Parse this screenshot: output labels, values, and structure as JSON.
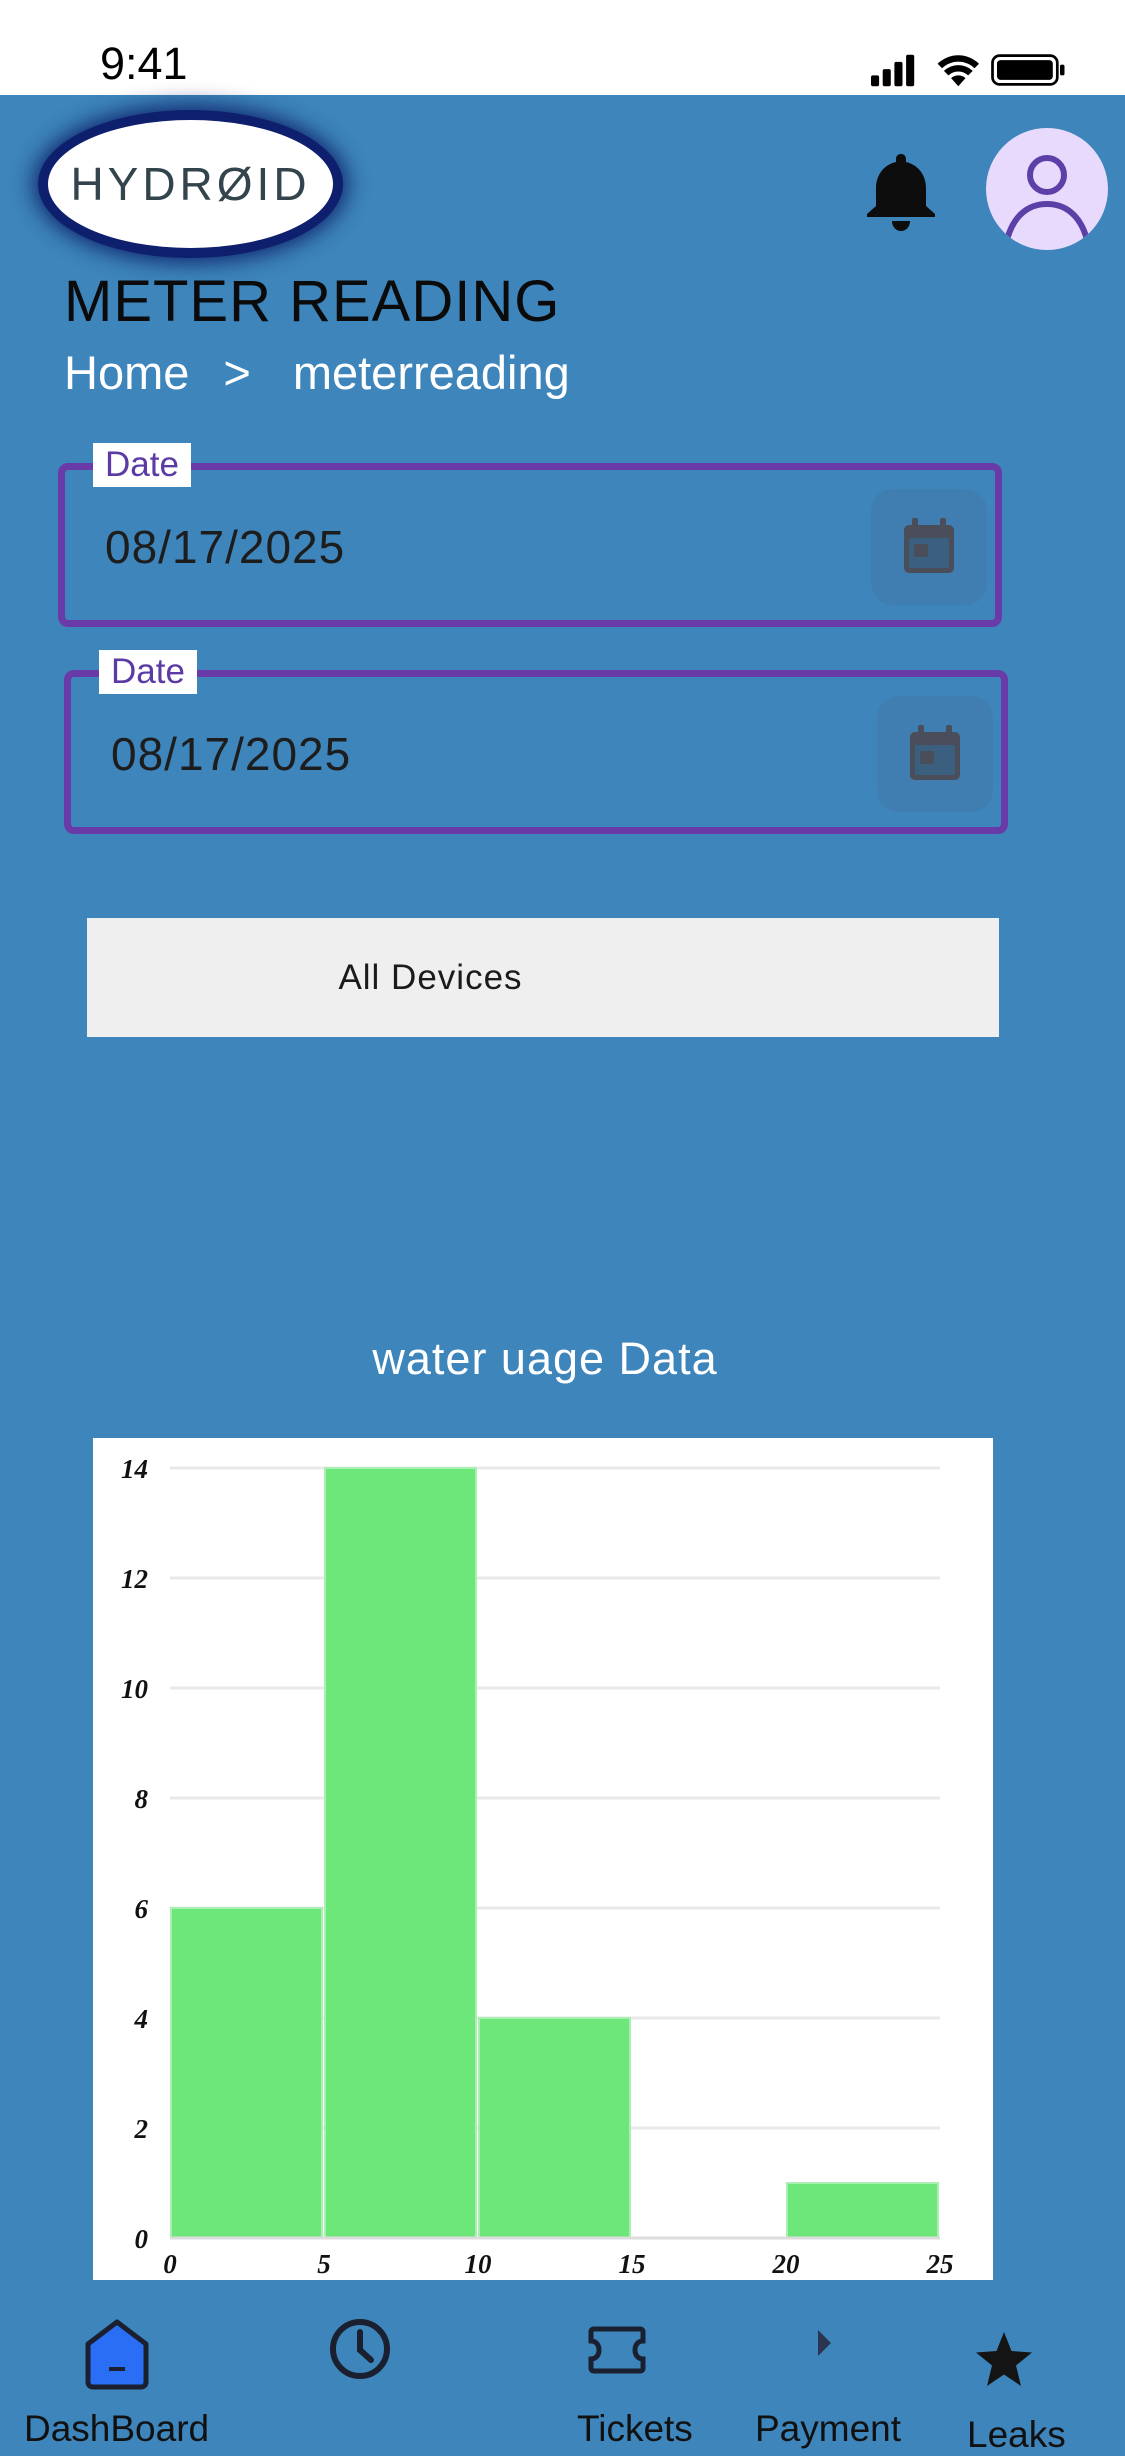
{
  "status_bar": {
    "time": "9:41"
  },
  "header": {
    "logo_text": "HYDRØID"
  },
  "page": {
    "title": "METER READING",
    "breadcrumb": {
      "home": "Home",
      "separator": ">",
      "current": "meterreading"
    }
  },
  "filters": {
    "start_date": {
      "label": "Date",
      "value": "08/17/2025"
    },
    "end_date": {
      "label": "Date",
      "value": "08/17/2025"
    },
    "device_select": {
      "label": "All  Devices"
    }
  },
  "chart_title": "water uage Data",
  "chart_data": {
    "type": "bar",
    "title": "water uage Data",
    "xlabel": "",
    "ylabel": "",
    "xlim": [
      0,
      25
    ],
    "ylim": [
      0,
      14
    ],
    "x_ticks": [
      0,
      5,
      10,
      15,
      20,
      25
    ],
    "y_ticks": [
      0,
      2,
      4,
      6,
      8,
      10,
      12,
      14
    ],
    "bins": [
      {
        "x0": 0,
        "x1": 5,
        "value": 6
      },
      {
        "x0": 5,
        "x1": 10,
        "value": 14
      },
      {
        "x0": 10,
        "x1": 15,
        "value": 4
      },
      {
        "x0": 15,
        "x1": 20,
        "value": 0
      },
      {
        "x0": 20,
        "x1": 25,
        "value": 1
      }
    ],
    "grid": true,
    "bar_color": "#6ee77a"
  },
  "bottom_nav": {
    "items": [
      {
        "label": "DashBoard",
        "icon": "home-icon"
      },
      {
        "label": "",
        "icon": "clock-icon"
      },
      {
        "label": "Tickets",
        "icon": "ticket-icon"
      },
      {
        "label": "Payment",
        "icon": "arrow-right-icon"
      },
      {
        "label": "Leaks",
        "icon": "star-icon"
      }
    ]
  },
  "colors": {
    "background": "#3d85bb",
    "field_border": "#6a3aa8",
    "accent_blue": "#2a6ef5"
  }
}
